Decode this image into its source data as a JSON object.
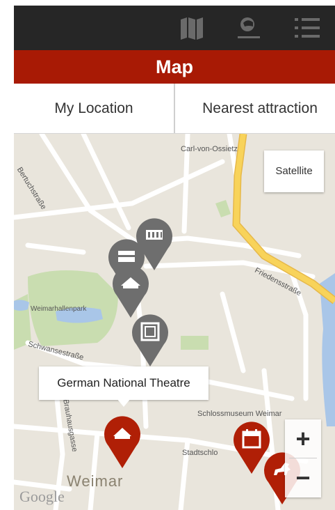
{
  "header": {
    "icons": [
      "map-book-icon",
      "location-person-icon",
      "menu-list-icon"
    ]
  },
  "title": "Map",
  "buttons": {
    "my_location": "My Location",
    "nearest_attraction": "Nearest attraction"
  },
  "map": {
    "satellite_label": "Satellite",
    "zoom_in": "+",
    "zoom_out": "−",
    "tooltip": "German National Theatre",
    "city_label": "Weimar",
    "attribution": "Google",
    "street_labels": [
      "Carl-von-Ossietz",
      "Bertuchstraße",
      "Friedensstraße",
      "Weimarhallenpark",
      "Schwansestraße",
      "Schlossmuseum Weimar",
      "Stadtschlo",
      "Brauhausgasse"
    ]
  },
  "colors": {
    "topbar": "#262626",
    "title_bar": "#a81a05",
    "pin_grey": "#6e6e6e",
    "pin_red": "#b01f06",
    "map_bg": "#e9e5dc",
    "park": "#c9ddb0",
    "water": "#a9c6e8",
    "highway": "#f8d35a"
  }
}
